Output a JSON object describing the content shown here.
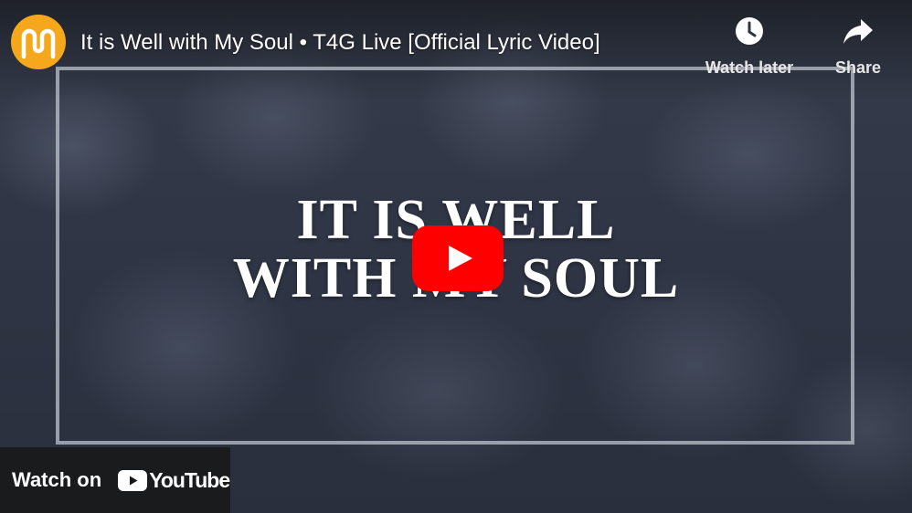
{
  "header": {
    "title": "It is Well with My Soul • T4G Live [Official Lyric Video]",
    "avatar_icon": "channel-logo-icon",
    "avatar_color": "#f6a81c"
  },
  "actions": {
    "watch_later_label": "Watch later",
    "watch_later_icon": "clock-icon",
    "share_label": "Share",
    "share_icon": "share-arrow-icon"
  },
  "video": {
    "lyric_line_1": "IT IS WELL",
    "lyric_line_2": "WITH MY SOUL",
    "play_icon": "youtube-play-icon",
    "play_color": "#ff0000"
  },
  "footer": {
    "watch_on_label": "Watch on",
    "brand": "YouTube"
  }
}
